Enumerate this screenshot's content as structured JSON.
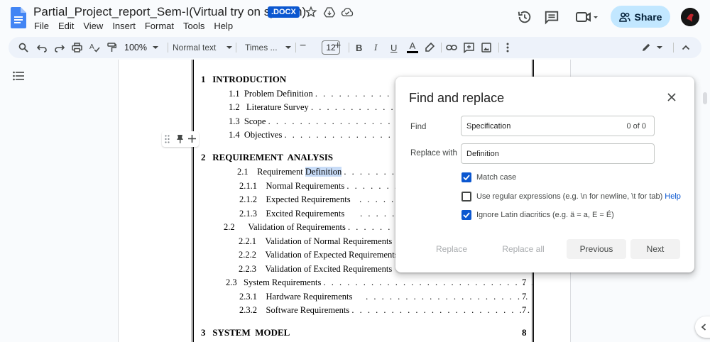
{
  "header": {
    "doc_title": "Partial_Project_report_Sem-I(Virtual try on system)",
    "badge": ".DOCX",
    "share_label": "Share"
  },
  "menu": [
    "File",
    "Edit",
    "View",
    "Insert",
    "Format",
    "Tools",
    "Help"
  ],
  "toolbar": {
    "zoom": "100%",
    "style": "Normal text",
    "font": "Times ...",
    "font_size": "12",
    "bold": "B",
    "italic": "I",
    "underline": "U",
    "text_color": "A"
  },
  "toc": {
    "h1": {
      "num": "1",
      "title": "INTRODUCTION"
    },
    "s11": {
      "num": "1.1",
      "title": "Problem Definition"
    },
    "s12": {
      "num": "1.2",
      "title": "Literature Survey"
    },
    "s13": {
      "num": "1.3",
      "title": "Scope"
    },
    "s14": {
      "num": "1.4",
      "title": "Objectives"
    },
    "h2": {
      "num": "2",
      "title": "REQUIREMENT  ANALYSIS"
    },
    "s21": {
      "num": "2.1",
      "title_before": "Requirement ",
      "title_highlight": "Definition"
    },
    "s211": {
      "num": "2.1.1",
      "title": "Normal Requirements"
    },
    "s212": {
      "num": "2.1.2",
      "title": "Expected Requirements"
    },
    "s213": {
      "num": "2.1.3",
      "title": "Excited Requirements"
    },
    "s22": {
      "num": "2.2",
      "title": "Validation of Requirements"
    },
    "s221": {
      "num": "2.2.1",
      "title": "Validation of Normal Requirements"
    },
    "s222": {
      "num": "2.2.2",
      "title": "Validation of Expected Requirements"
    },
    "s223": {
      "num": "2.2.3",
      "title": "Validation of Excited Requirements"
    },
    "s23": {
      "num": "2.3",
      "title": "System Requirements",
      "page": "7"
    },
    "s231": {
      "num": "2.3.1",
      "title": "Hardware Requirements",
      "page": "7"
    },
    "s232": {
      "num": "2.3.2",
      "title": "Software Requirements",
      "page": "7"
    },
    "h3": {
      "num": "3",
      "title": "SYSTEM  MODEL",
      "page": "8"
    }
  },
  "dialog": {
    "title": "Find and replace",
    "find_label": "Find",
    "find_value": "Specification",
    "find_count": "0 of 0",
    "replace_label": "Replace with",
    "replace_value": "Definition",
    "match_case": "Match case",
    "regex": "Use regular expressions (e.g. \\n for newline, \\t for tab)",
    "help": "Help",
    "diacritics": "Ignore Latin diacritics (e.g. ä = a, E = É)",
    "btn_replace": "Replace",
    "btn_replace_all": "Replace all",
    "btn_previous": "Previous",
    "btn_next": "Next",
    "match_case_checked": true,
    "regex_checked": false,
    "diacritics_checked": true
  },
  "colors": {
    "accent": "#0b57d0",
    "share_bg": "#c2e7ff",
    "highlight": "#c8dcf7"
  },
  "icons": [
    "docs-logo-icon",
    "star-icon",
    "move-to-drive-icon",
    "cloud-saved-icon",
    "history-icon",
    "comment-icon",
    "meet-icon",
    "people-icon",
    "search-icon",
    "undo-icon",
    "redo-icon",
    "print-icon",
    "spellcheck-icon",
    "paint-format-icon",
    "highlighter-icon",
    "link-icon",
    "add-comment-icon",
    "image-icon",
    "more-icon",
    "pencil-icon",
    "chevron-up-icon",
    "outline-icon",
    "close-icon"
  ]
}
